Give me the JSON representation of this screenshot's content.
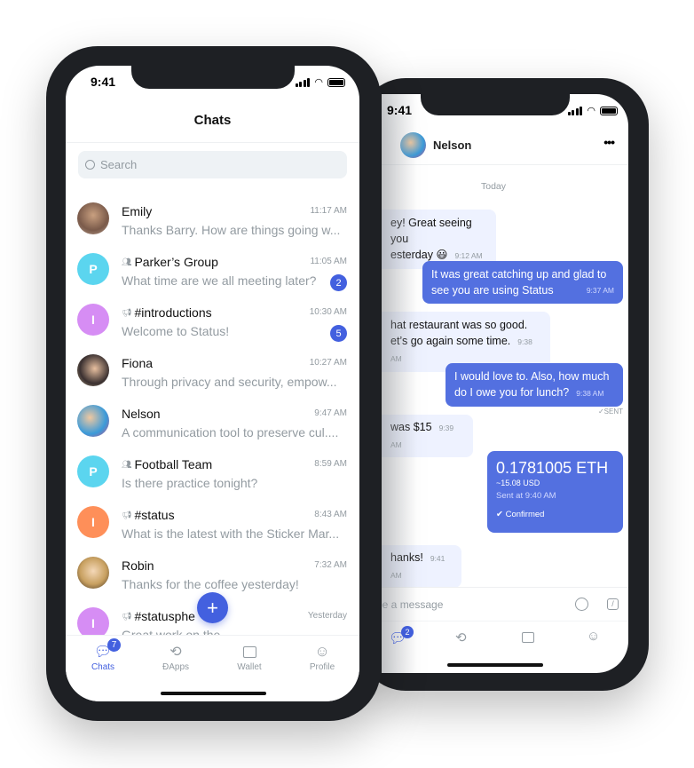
{
  "colors": {
    "accent": "#4360df",
    "bubble_out": "#5370e0",
    "bubble_in": "#eef2ff",
    "frame": "#1e2024"
  },
  "left_phone": {
    "status_time": "9:41",
    "title": "Chats",
    "search": {
      "placeholder": "Search",
      "icon": "search-icon"
    },
    "chats": [
      {
        "name": "Emily",
        "preview": "Thanks Barry. How are things going w...",
        "time": "11:17 AM",
        "type": "contact",
        "avatar": "photo"
      },
      {
        "name": "Parker’s Group",
        "preview": "What time are we all meeting later?",
        "time": "11:05 AM",
        "type": "group",
        "initial": "P",
        "color": "#5bd5ef",
        "unread": "2"
      },
      {
        "name": "#introductions",
        "preview": "Welcome to Status!",
        "time": "10:30 AM",
        "type": "channel",
        "initial": "I",
        "color": "#d68df4",
        "unread": "5"
      },
      {
        "name": "Fiona",
        "preview": "Through privacy and security, empow...",
        "time": "10:27 AM",
        "type": "contact",
        "avatar": "photo"
      },
      {
        "name": "Nelson",
        "preview": "A communication tool to preserve cul....",
        "time": "9:47 AM",
        "type": "contact",
        "avatar": "photo"
      },
      {
        "name": "Football Team",
        "preview": "Is there practice tonight?",
        "time": "8:59 AM",
        "type": "group",
        "initial": "P",
        "color": "#5bd5ef"
      },
      {
        "name": "#status",
        "preview": "What is the latest with the Sticker Mar...",
        "time": "8:43 AM",
        "type": "channel",
        "initial": "I",
        "color": "#fe8f59"
      },
      {
        "name": "Robin",
        "preview": "Thanks for the coffee yesterday!",
        "time": "7:32 AM",
        "type": "contact",
        "avatar": "photo"
      },
      {
        "name": "#statusphe",
        "preview": "Great work on the",
        "time": "Yesterday",
        "type": "channel",
        "initial": "I",
        "color": "#d68df4"
      }
    ],
    "fab_label": "+",
    "tabs": [
      {
        "label": "Chats",
        "badge": "7",
        "active": true
      },
      {
        "label": "ÐApps"
      },
      {
        "label": "Wallet"
      },
      {
        "label": "Profile"
      }
    ]
  },
  "right_phone": {
    "status_time": "9:41",
    "contact_name": "Nelson",
    "day_label": "Today",
    "messages": [
      {
        "dir": "in",
        "lines": [
          "ey! Great seeing you",
          "esterday 😃"
        ],
        "time": "9:12 AM"
      },
      {
        "dir": "out",
        "lines": [
          "It was great catching up and glad to",
          "see you are using Status"
        ],
        "time": "9:37 AM"
      },
      {
        "dir": "in",
        "lines": [
          "hat restaurant was so good.",
          "et’s go again some time."
        ],
        "time": "9:38 AM"
      },
      {
        "dir": "out",
        "lines": [
          "I would love to. Also, how much",
          "do I owe you for lunch?"
        ],
        "time": "9:38 AM",
        "status": "SENT"
      },
      {
        "dir": "in",
        "lines": [
          "was $15"
        ],
        "time": "9:39 AM"
      },
      {
        "dir": "in",
        "lines": [
          "hanks!"
        ],
        "time": "9:41 AM"
      }
    ],
    "transaction": {
      "amount": "0.1781005 ETH",
      "fiat": "~15.08 USD",
      "sent": "Sent at 9:40 AM",
      "status": "Confirmed"
    },
    "input_placeholder": "pe a message",
    "tab_badge": "2"
  }
}
